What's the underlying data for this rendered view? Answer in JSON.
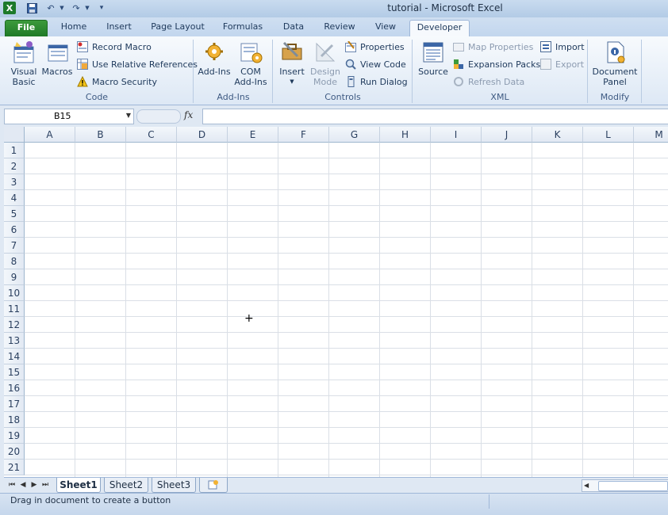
{
  "window": {
    "title": "tutorial  -  Microsoft Excel"
  },
  "qat": {
    "app_icon": "excel-logo-icon",
    "items": [
      "save-icon",
      "undo-icon",
      "redo-icon",
      "customize-qat-icon"
    ]
  },
  "tabs": [
    "File",
    "Home",
    "Insert",
    "Page Layout",
    "Formulas",
    "Data",
    "Review",
    "View",
    "Developer"
  ],
  "ribbon": {
    "code": {
      "label": "Code",
      "visual_basic": "Visual\nBasic",
      "macros": "Macros",
      "record_macro": "Record Macro",
      "use_relative_references": "Use Relative References",
      "macro_security": "Macro Security"
    },
    "addins": {
      "label": "Add-Ins",
      "addins": "Add-Ins",
      "com_addins": "COM\nAdd-Ins"
    },
    "controls": {
      "label": "Controls",
      "insert": "Insert",
      "design_mode": "Design\nMode",
      "properties": "Properties",
      "view_code": "View Code",
      "run_dialog": "Run Dialog"
    },
    "xml": {
      "label": "XML",
      "source": "Source",
      "map_properties": "Map Properties",
      "expansion_packs": "Expansion Packs",
      "refresh_data": "Refresh Data",
      "import": "Import",
      "export": "Export"
    },
    "modify": {
      "label": "Modify",
      "document_panel": "Document\nPanel"
    }
  },
  "formula_bar": {
    "name_box": "B15",
    "fx": "fx",
    "formula": ""
  },
  "grid": {
    "columns": [
      "A",
      "B",
      "C",
      "D",
      "E",
      "F",
      "G",
      "H",
      "I",
      "J",
      "K",
      "L",
      "M"
    ],
    "rows": [
      "1",
      "2",
      "3",
      "4",
      "5",
      "6",
      "7",
      "8",
      "9",
      "10",
      "11",
      "12",
      "13",
      "14",
      "15",
      "16",
      "17",
      "18",
      "19",
      "20",
      "21"
    ]
  },
  "sheets": [
    "Sheet1",
    "Sheet2",
    "Sheet3"
  ],
  "status": {
    "message": "Drag in document to create a button"
  },
  "colors": {
    "file_tab": "#1f7a27",
    "ribbon_bg": "#dde8f5",
    "grid_line": "#dadfe6"
  }
}
